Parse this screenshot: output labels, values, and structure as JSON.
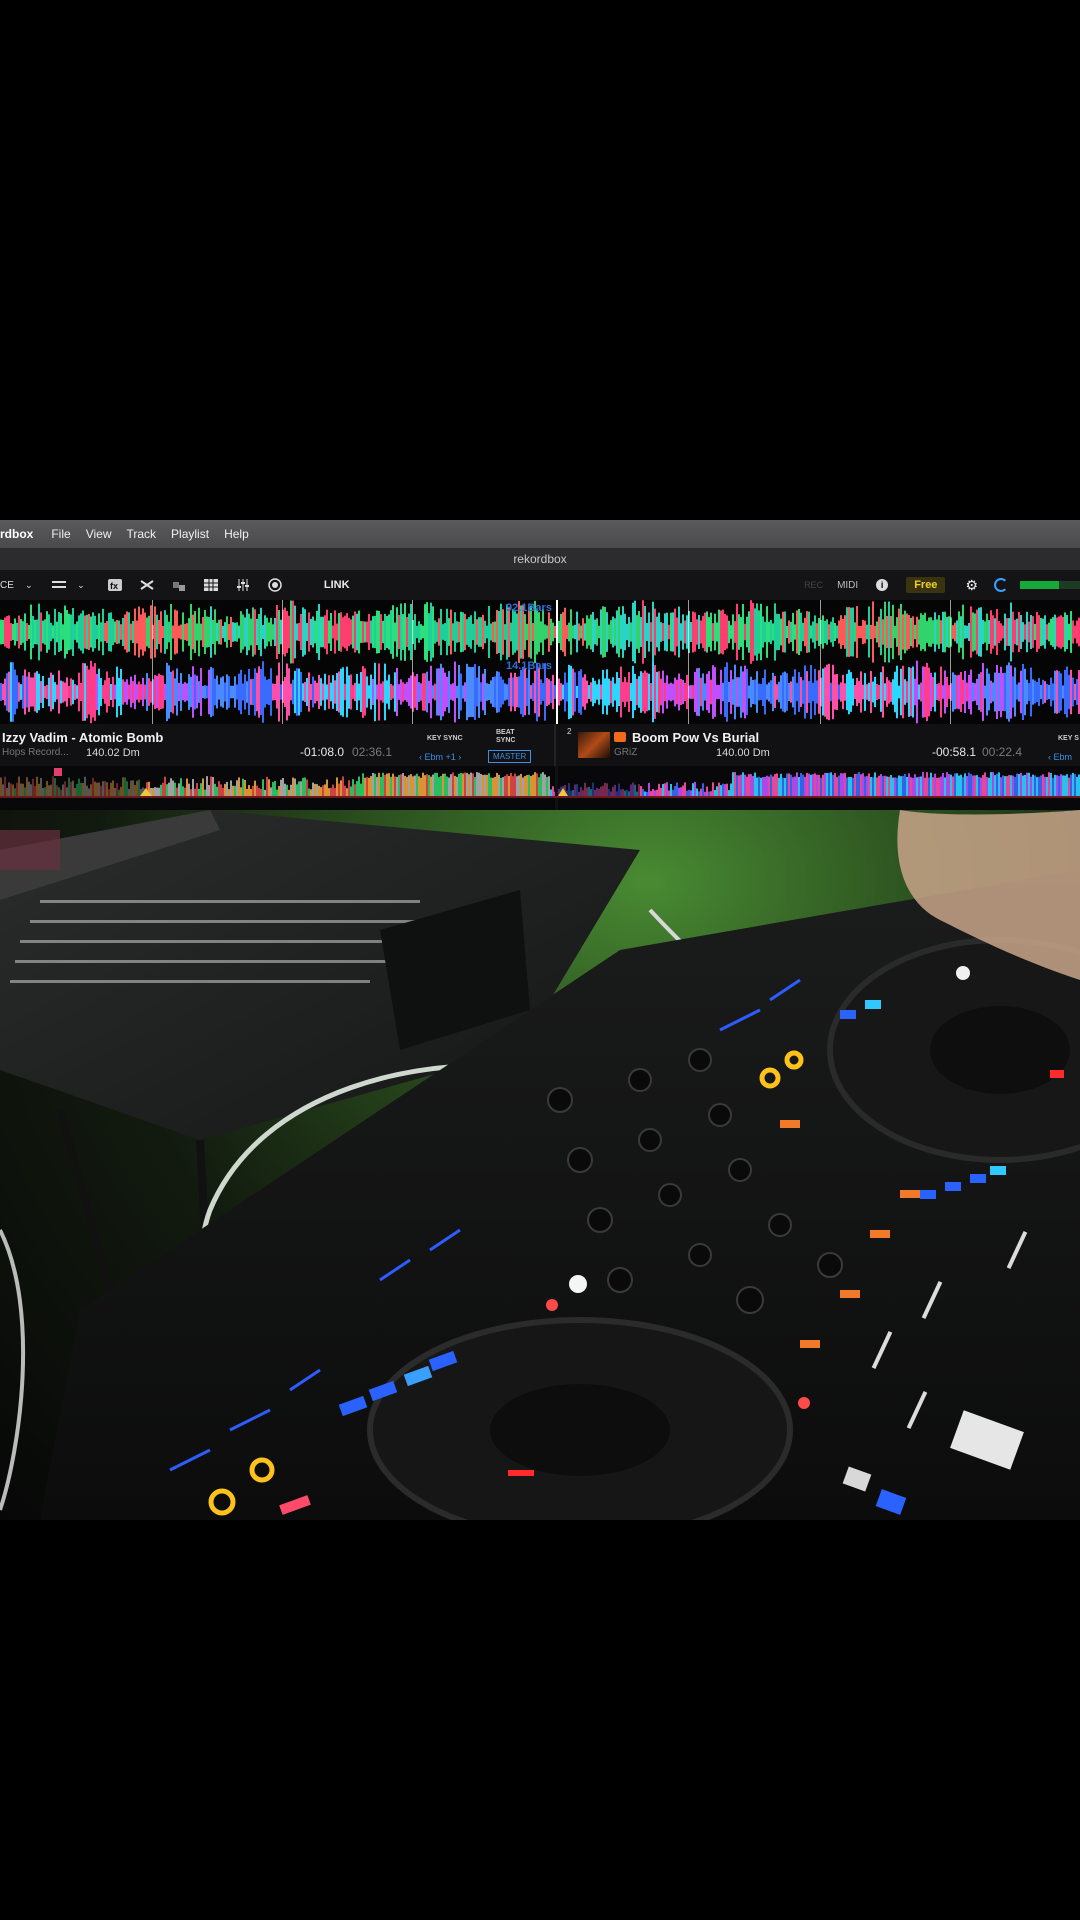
{
  "menubar": {
    "app_name": "rdbox",
    "items": [
      "File",
      "View",
      "Track",
      "Playlist",
      "Help"
    ]
  },
  "window": {
    "title": "rekordbox"
  },
  "toolbar": {
    "left_label": "CE",
    "link_label": "LINK",
    "midi_label": "MIDI",
    "free_label": "Free",
    "rec_label": "REC"
  },
  "waveform": {
    "deck1_bars": "92.1Bars",
    "deck2_bars": "14.1Bars"
  },
  "deck1": {
    "title": "Izzy Vadim - Atomic Bomb",
    "label": "Hops Record...",
    "bpm_key": "140.02 Dm",
    "time_remaining": "-01:08.0",
    "time_elapsed": "02:36.1",
    "key_sync_label": "KEY SYNC",
    "beat_sync_label": "BEAT SYNC",
    "key_value": "‹  Ebm  +1  ›",
    "master_label": "MASTER"
  },
  "deck2": {
    "number": "2",
    "title": "Boom Pow Vs Burial",
    "artist": "GRiZ",
    "bpm_key": "140.00 Dm",
    "time_remaining": "-00:58.1",
    "time_elapsed": "00:22.4",
    "key_sync_label": "KEY S",
    "key_value": "‹  Ebm"
  },
  "colors": {
    "accent_blue": "#2f6fd6",
    "free_badge": "#f2d02b",
    "menubar": "#4f4f51"
  },
  "icons": [
    "chevron-down-icon",
    "layout-icon",
    "fx-icon",
    "shuffle-icon",
    "sampler-icon",
    "grid-icon",
    "mixer-icon",
    "record-icon",
    "info-icon",
    "gear-icon",
    "sync-spinner-icon",
    "level-meter-icon"
  ]
}
